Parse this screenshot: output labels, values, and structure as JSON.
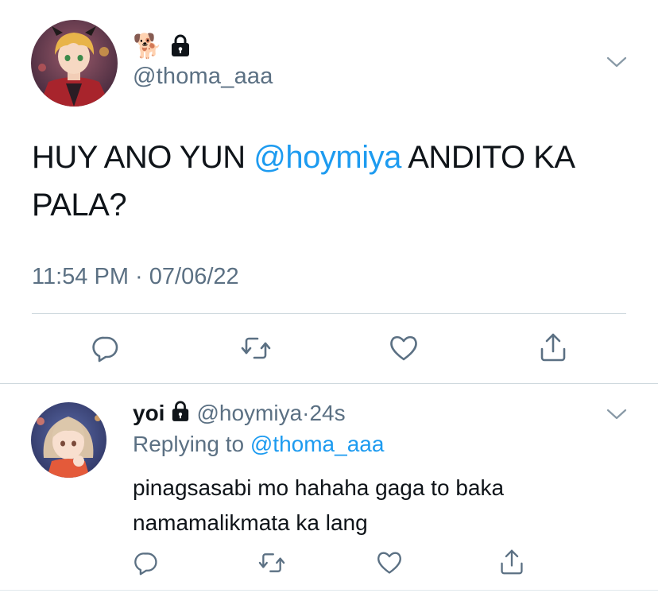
{
  "main_tweet": {
    "display_name_emoji": "🐕",
    "handle": "@thoma_aaa",
    "text_before": "HUY ANO YUN ",
    "mention": "@hoymiya",
    "text_after": " ANDITO KA PALA?",
    "time": "11:54 PM",
    "separator": " · ",
    "date": "07/06/22",
    "protected": true
  },
  "reply_tweet": {
    "display_name": "yoi",
    "handle": "@hoymiya",
    "separator": " · ",
    "time_ago": "24s",
    "replying_prefix": "Replying to ",
    "replying_to": "@thoma_aaa",
    "text": "pinagsasabi mo hahaha gaga to baka namamalikmata ka lang",
    "protected": true
  },
  "actions": [
    "reply-icon",
    "retweet-icon",
    "like-icon",
    "share-icon"
  ],
  "colors": {
    "accent": "#1d9bf0",
    "secondary_text": "#5b7083",
    "primary_text": "#0f1419",
    "divider": "#cfd9de"
  }
}
